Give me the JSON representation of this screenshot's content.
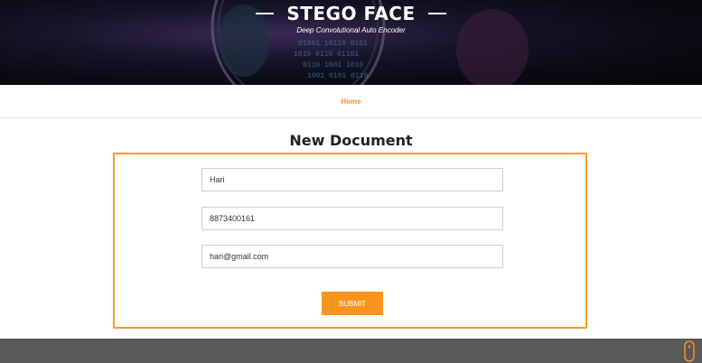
{
  "header": {
    "title": "STEGO FACE",
    "subtitle": "Deep Convolutional Auto Encoder"
  },
  "nav": {
    "items": [
      {
        "label": "Home"
      }
    ]
  },
  "page": {
    "title": "New Document"
  },
  "form": {
    "name_value": "Hari",
    "phone_value": "8873400161",
    "email_value": "hari@gmail.com",
    "submit_label": "SUBMIT"
  },
  "colors": {
    "accent": "#f7941d",
    "footer": "#595959"
  },
  "icons": {
    "scroll": "mouse-scroll-icon"
  }
}
